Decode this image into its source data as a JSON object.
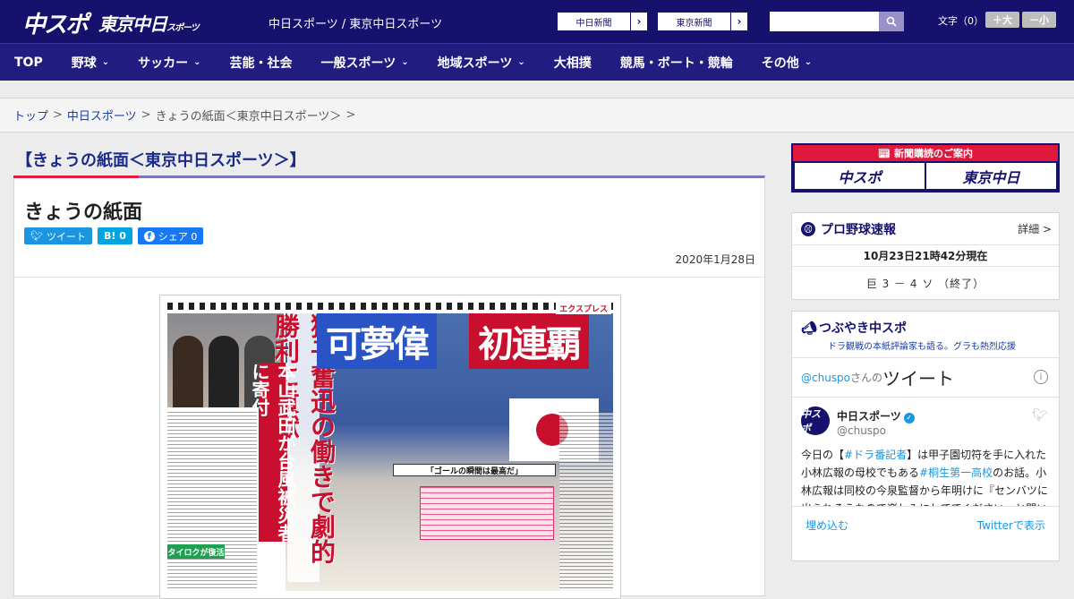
{
  "header": {
    "logo_chuspo": "中スポ",
    "logo_tokyo": "東京中日",
    "logo_tokyo_small": "スポーツ",
    "site_links": "中日スポーツ / 東京中日スポーツ",
    "ext_buttons": [
      {
        "label": "中日新聞",
        "arrow": "›"
      },
      {
        "label": "東京新聞",
        "arrow": "›"
      }
    ],
    "search_placeholder": "",
    "font_size_label": "文字（0）",
    "font_larger": "＋大",
    "font_smaller": "－小"
  },
  "nav": {
    "items": [
      {
        "label": "TOP",
        "chevron": ""
      },
      {
        "label": "野球",
        "chevron": "⌄"
      },
      {
        "label": "サッカー",
        "chevron": "⌄"
      },
      {
        "label": "芸能・社会",
        "chevron": ""
      },
      {
        "label": "一般スポーツ",
        "chevron": "⌄"
      },
      {
        "label": "地域スポーツ",
        "chevron": "⌄"
      },
      {
        "label": "大相撲",
        "chevron": ""
      },
      {
        "label": "競馬・ボート・競輪",
        "chevron": ""
      },
      {
        "label": "その他",
        "chevron": "⌄"
      }
    ]
  },
  "breadcrumb": {
    "items": [
      "トップ",
      "中日スポーツ",
      "きょうの紙面＜東京中日スポーツ＞"
    ],
    "separator": ">"
  },
  "main": {
    "page_heading": "【きょうの紙面＜東京中日スポーツ＞】",
    "article_title": "きょうの紙面",
    "share": {
      "tweet": "ツイート",
      "hatena": "B! 0",
      "facebook": "シェア 0"
    },
    "date": "2020年1月28日",
    "paper": {
      "headline_blue": "可夢偉",
      "headline_red": "初連覇",
      "vertical_red": "本山武田が台風被災者に寄付",
      "vertical_main": "獅子奮迅の働きで劇的勝利に貢献",
      "goal_caption": "「ゴールの瞬間は最高だ」",
      "green_tag": "タイロクが復活",
      "tagline": "エクスプレス"
    }
  },
  "sidebar": {
    "subscribe_head": "新聞購読のご案内",
    "subscribe_logos": [
      "中スポ",
      "東京中日"
    ],
    "baseball": {
      "title": "プロ野球速報",
      "more": "詳細 >",
      "time": "10月23日21時42分現在",
      "score": "巨 3 － 4 ソ （終了）"
    },
    "twitter": {
      "title": "つぶやき中スポ",
      "subtitle": "ドラ観戦の本紙評論家も語る。グラも熱烈応援",
      "handle": "@chuspo",
      "handle_suffix": "さんの",
      "word": "ツイート",
      "tweet_name": "中日スポーツ",
      "tweet_user": "@chuspo",
      "tweet_pre": "今日の【",
      "tweet_tag1": "#ドラ番記者",
      "tweet_mid1": "】は甲子園切符を手に入れた小林広報の母校でもある",
      "tweet_tag2": "#桐生第一高校",
      "tweet_mid2": "のお話。小林広報は同校の今泉監督から年明けに『センバツに出られそうなので楽しみにしててください』と聞い",
      "embed": "埋め込む",
      "view_on_twitter": "Twitterで表示"
    }
  }
}
